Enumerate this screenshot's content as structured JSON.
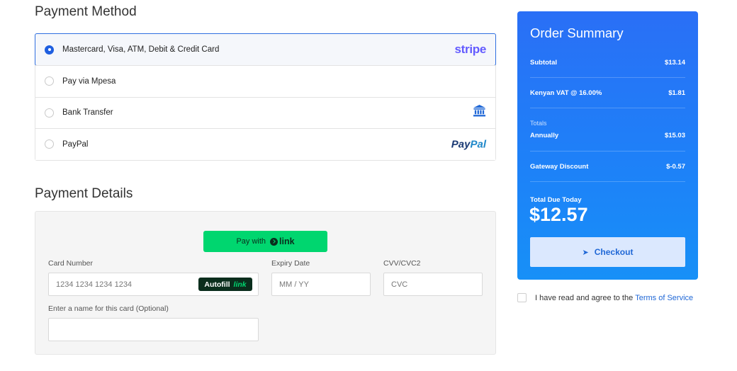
{
  "payment_method": {
    "title": "Payment Method",
    "options": [
      {
        "label": "Mastercard, Visa, ATM, Debit & Credit Card",
        "logo": "stripe",
        "logo_text": "stripe",
        "selected": true
      },
      {
        "label": "Pay via Mpesa",
        "logo": "",
        "selected": false
      },
      {
        "label": "Bank Transfer",
        "logo": "bank-icon",
        "selected": false
      },
      {
        "label": "PayPal",
        "logo": "paypal",
        "logo_text_1": "Pay",
        "logo_text_2": "Pal",
        "selected": false
      }
    ]
  },
  "payment_details": {
    "title": "Payment Details",
    "pay_with_link": {
      "prefix": "Pay with",
      "brand": "link"
    },
    "card_number": {
      "label": "Card Number",
      "placeholder": "1234 1234 1234 1234",
      "autofill": "Autofill",
      "autofill_brand": "link"
    },
    "expiry": {
      "label": "Expiry Date",
      "placeholder": "MM / YY"
    },
    "cvv": {
      "label": "CVV/CVC2",
      "placeholder": "CVC"
    },
    "card_name": {
      "label": "Enter a name for this card (Optional)",
      "value": ""
    }
  },
  "order_summary": {
    "title": "Order Summary",
    "subtotal": {
      "label": "Subtotal",
      "value": "$13.14"
    },
    "vat": {
      "label": "Kenyan VAT @ 16.00%",
      "value": "$1.81"
    },
    "totals_heading": "Totals",
    "annually": {
      "label": "Annually",
      "value": "$15.03"
    },
    "gateway_discount": {
      "label": "Gateway Discount",
      "value": "$-0.57"
    },
    "total_due": {
      "label": "Total Due Today",
      "value": "$12.57"
    },
    "checkout_label": "Checkout"
  },
  "terms": {
    "text": "I have read and agree to the",
    "link": "Terms of Service"
  },
  "colors": {
    "accent": "#1f67d6",
    "summary_bg": "#2a6ff6",
    "link_green": "#00d66f",
    "stripe": "#635bff"
  }
}
